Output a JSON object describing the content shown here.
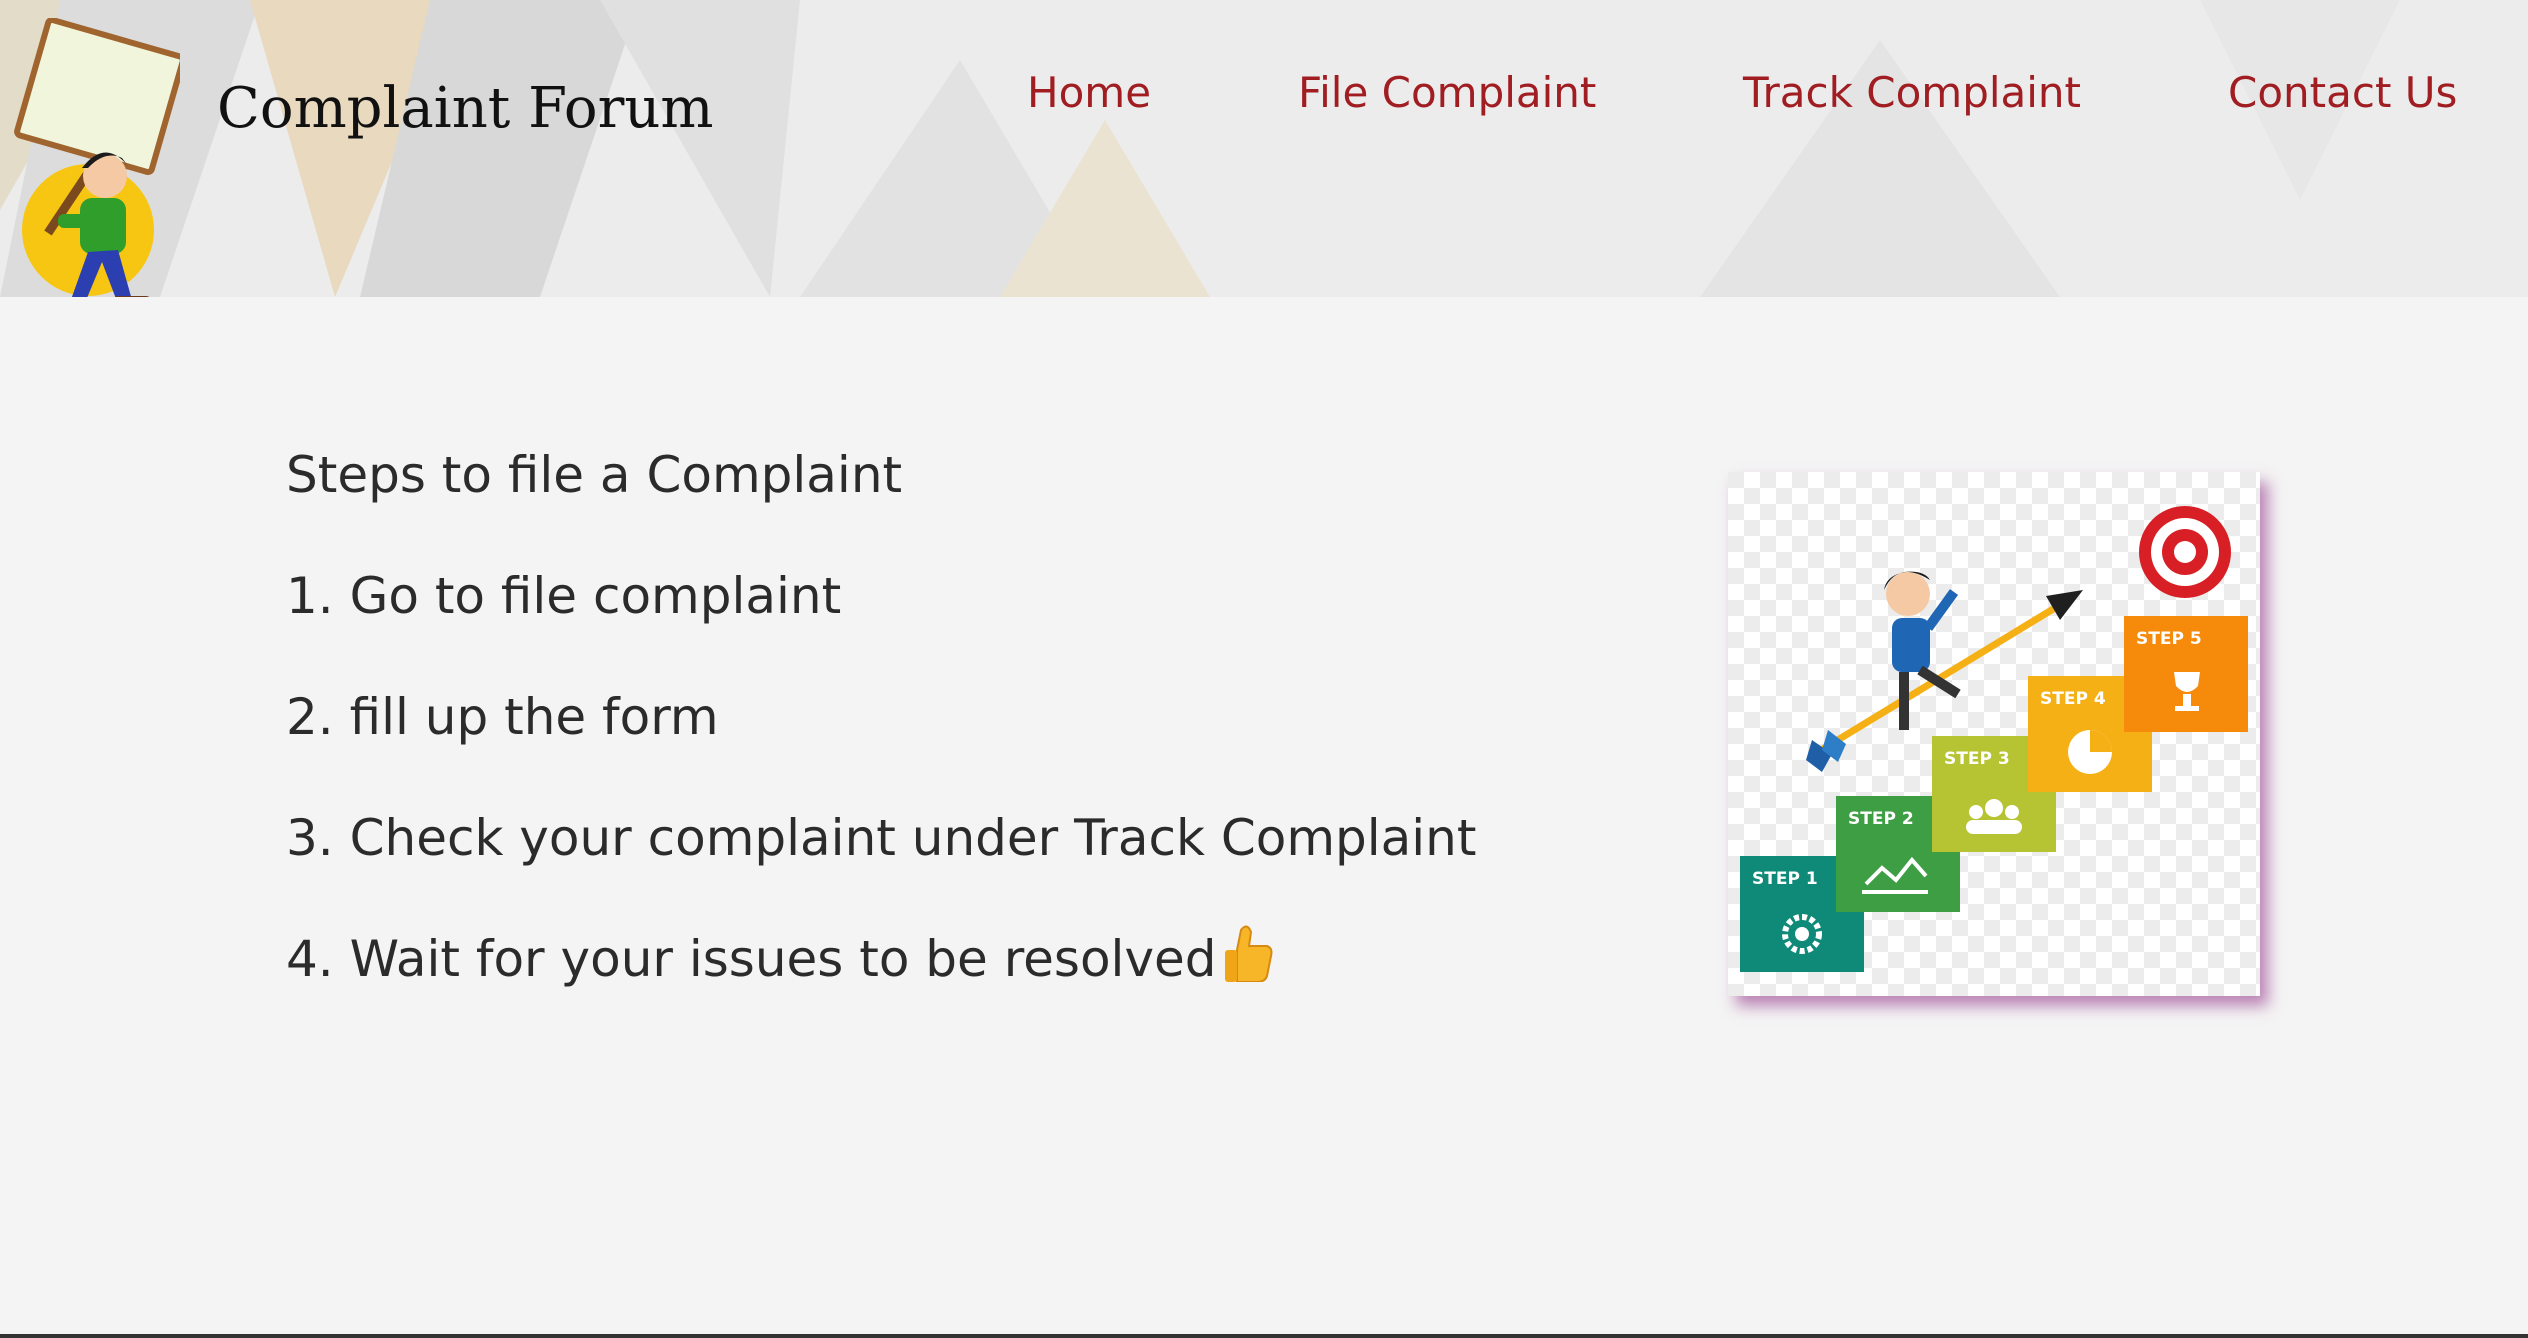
{
  "header": {
    "site_title": "Complaint Forum"
  },
  "nav": {
    "items": [
      {
        "label": "Home"
      },
      {
        "label": "File Complaint"
      },
      {
        "label": "Track Complaint"
      },
      {
        "label": "Contact Us"
      }
    ]
  },
  "content": {
    "heading": "Steps to file a Complaint",
    "steps": [
      "1. Go to file complaint",
      "2. fill up the form",
      "3. Check your complaint under Track Complaint",
      "4. Wait for your issues to be resolved"
    ],
    "step_emoji_icon": "thumbs-up-icon"
  },
  "illustration": {
    "step_labels": [
      "STEP 1",
      "STEP 2",
      "STEP 3",
      "STEP 4",
      "STEP 5"
    ],
    "step_colors": [
      "#0f8a78",
      "#3d9e44",
      "#b6c433",
      "#f5b016",
      "#f68a0a"
    ]
  },
  "colors": {
    "nav_link": "#a01d22",
    "page_background": "#f4f4f4",
    "header_background": "#ececec"
  }
}
